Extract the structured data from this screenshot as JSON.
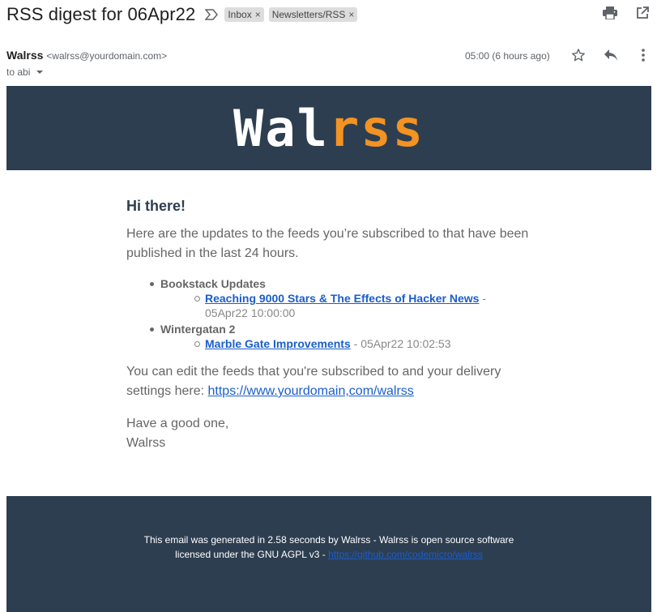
{
  "subject": "RSS digest for 06Apr22",
  "labels": [
    {
      "name": "Inbox",
      "remove": "×"
    },
    {
      "name": "Newsletters/RSS",
      "remove": "×"
    }
  ],
  "toolbar_icons": [
    "print-icon",
    "open-in-new-window-icon"
  ],
  "sender": {
    "name": "Walrss",
    "email": "<walrss@yourdomain.com>",
    "to": "to abi",
    "time": "05:00 (6 hours ago)"
  },
  "message_icons": [
    "star-icon",
    "reply-icon",
    "more-options-icon"
  ],
  "email": {
    "logo_part1": "Wal",
    "logo_part2": "rss",
    "greeting": "Hi there!",
    "intro": "Here are the updates to the feeds you’re subscribed to that have been published in the last 24 hours.",
    "feeds": [
      {
        "title": "Bookstack Updates",
        "items": [
          {
            "link": "Reaching 9000 Stars & The Effects of Hacker News",
            "sep": " - ",
            "date": "05Apr22 10:00:00"
          }
        ]
      },
      {
        "title": "Wintergatan 2",
        "items": [
          {
            "link": "Marble Gate Improvements",
            "sep": " - ",
            "date": "05Apr22 10:02:53"
          }
        ]
      }
    ],
    "edit_text": "You can edit the feeds that you're subscribed to and your delivery settings here: ",
    "edit_link": "https://www.yourdomain,com/walrss",
    "signoff_1": "Have a good one,",
    "signoff_2": "Walrss",
    "footer_line1": "This email was generated in 2.58 seconds by Walrss - Walrss is open source software",
    "footer_line2_text": "licensed under the GNU AGPL v3 - ",
    "footer_link": "https://github.com/codemicro/walrss"
  },
  "colors": {
    "banner_bg": "#2d3e50",
    "logo_accent": "#f29322",
    "link": "#1a5ecc"
  }
}
